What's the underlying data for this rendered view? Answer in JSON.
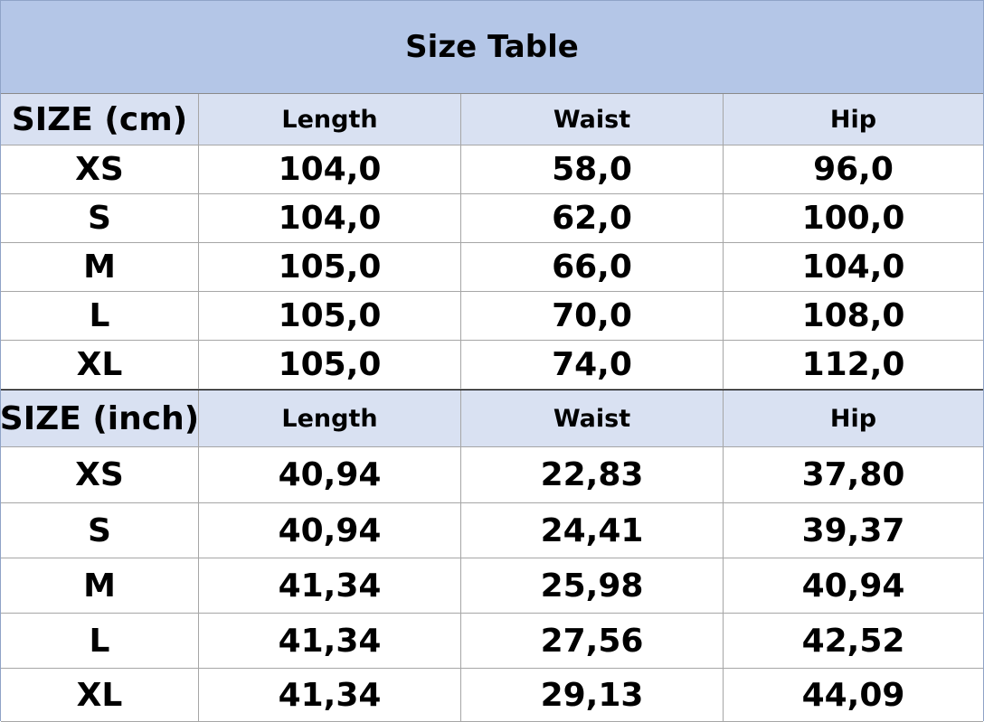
{
  "title": "Size Table",
  "cm_table": {
    "headers": [
      "SIZE (cm)",
      "Length",
      "Waist",
      "Hip"
    ],
    "rows": [
      [
        "XS",
        "104,0",
        "58,0",
        "96,0"
      ],
      [
        "S",
        "104,0",
        "62,0",
        "100,0"
      ],
      [
        "M",
        "105,0",
        "66,0",
        "104,0"
      ],
      [
        "L",
        "105,0",
        "70,0",
        "108,0"
      ],
      [
        "XL",
        "105,0",
        "74,0",
        "112,0"
      ]
    ]
  },
  "inch_table": {
    "headers": [
      "SIZE (inch)",
      "Length",
      "Waist",
      "Hip"
    ],
    "rows": [
      [
        "XS",
        "40,94",
        "22,83",
        "37,80"
      ],
      [
        "S",
        "40,94",
        "24,41",
        "39,37"
      ],
      [
        "M",
        "41,34",
        "25,98",
        "40,94"
      ],
      [
        "L",
        "41,34",
        "27,56",
        "42,52"
      ],
      [
        "XL",
        "41,34",
        "29,13",
        "44,09"
      ]
    ]
  },
  "colors": {
    "title_background": "#b4c6e7",
    "header_background": "#d9e1f2",
    "grid_line": "#a6a6a6"
  }
}
